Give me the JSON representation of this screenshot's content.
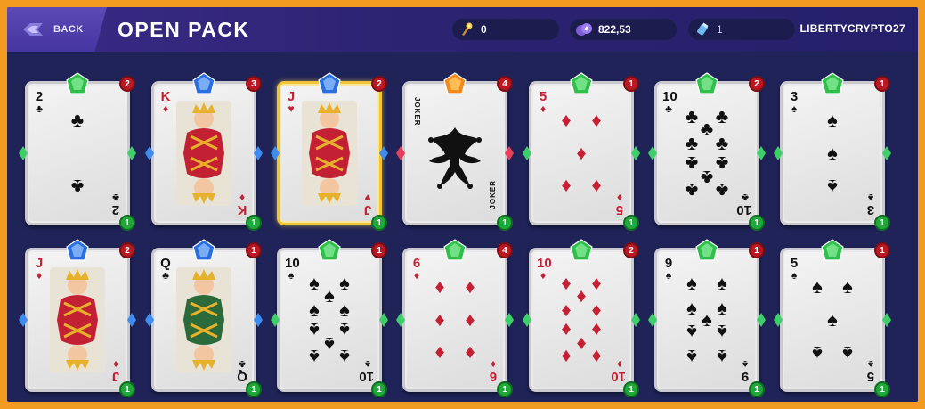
{
  "header": {
    "back_label": "BACK",
    "title": "OPEN PACK",
    "stats": [
      {
        "icon": "torch-icon",
        "value": "0"
      },
      {
        "icon": "spades-coin-icon",
        "value": "822,53"
      },
      {
        "icon": "potion-icon",
        "value": "1"
      }
    ],
    "username": "LIBERTYCRYPTO27"
  },
  "colors": {
    "accent": "#f39a21",
    "panel": "#1f2358",
    "green_gem": "#2fbf4a",
    "blue_gem": "#2a6fe0",
    "gold_gem": "#f08a1e",
    "red": "#c42034"
  },
  "cards": [
    {
      "rank": "2",
      "suit": "♣",
      "color": "blk",
      "gem": "green",
      "level": "2",
      "count": "1",
      "type": "pips"
    },
    {
      "rank": "K",
      "suit": "♦",
      "color": "red",
      "gem": "blue",
      "level": "3",
      "count": "1",
      "type": "face"
    },
    {
      "rank": "J",
      "suit": "♥",
      "color": "red",
      "gem": "blue",
      "level": "2",
      "count": "1",
      "type": "face",
      "gold": true
    },
    {
      "rank": "",
      "suit": "",
      "color": "blk",
      "gem": "gold",
      "level": "4",
      "count": "1",
      "type": "joker",
      "joker_label": "JOKER"
    },
    {
      "rank": "5",
      "suit": "♦",
      "color": "red",
      "gem": "green",
      "level": "1",
      "count": "1",
      "type": "pips"
    },
    {
      "rank": "10",
      "suit": "♣",
      "color": "blk",
      "gem": "green",
      "level": "2",
      "count": "1",
      "type": "pips"
    },
    {
      "rank": "3",
      "suit": "♠",
      "color": "blk",
      "gem": "green",
      "level": "1",
      "count": "1",
      "type": "pips"
    },
    {
      "rank": "J",
      "suit": "♦",
      "color": "red",
      "gem": "blue",
      "level": "2",
      "count": "1",
      "type": "face"
    },
    {
      "rank": "Q",
      "suit": "♣",
      "color": "blk",
      "gem": "blue",
      "level": "1",
      "count": "1",
      "type": "face"
    },
    {
      "rank": "10",
      "suit": "♠",
      "color": "blk",
      "gem": "green",
      "level": "1",
      "count": "1",
      "type": "pips"
    },
    {
      "rank": "6",
      "suit": "♦",
      "color": "red",
      "gem": "green",
      "level": "4",
      "count": "1",
      "type": "pips"
    },
    {
      "rank": "10",
      "suit": "♦",
      "color": "red",
      "gem": "green",
      "level": "2",
      "count": "1",
      "type": "pips"
    },
    {
      "rank": "9",
      "suit": "♠",
      "color": "blk",
      "gem": "green",
      "level": "1",
      "count": "1",
      "type": "pips"
    },
    {
      "rank": "5",
      "suit": "♠",
      "color": "blk",
      "gem": "green",
      "level": "1",
      "count": "1",
      "type": "pips"
    }
  ]
}
